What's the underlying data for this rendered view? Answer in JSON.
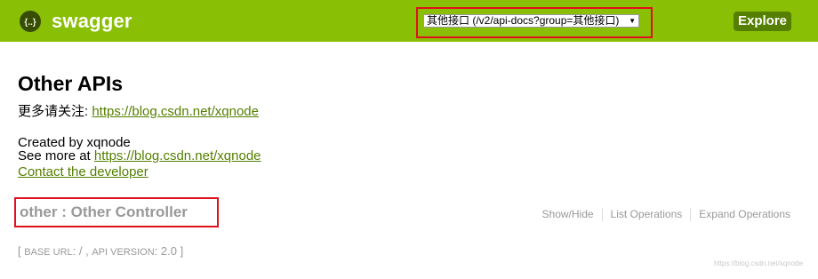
{
  "header": {
    "logo_text": "swagger",
    "api_select_value": "其他接口 (/v2/api-docs?group=其他接口)",
    "explore_label": "Explore",
    "colors": {
      "bar": "#89bf04",
      "button": "#547f00",
      "highlight": "#e0101c"
    }
  },
  "info": {
    "title": "Other APIs",
    "desc_prefix": "更多请关注: ",
    "desc_link": "https://blog.csdn.net/xqnode",
    "created_by": "Created by xqnode",
    "see_more_prefix": "See more at ",
    "see_more_link": "https://blog.csdn.net/xqnode",
    "contact": "Contact the developer"
  },
  "resource": {
    "title": "other : Other Controller",
    "ops": [
      "Show/Hide",
      "List Operations",
      "Expand Operations"
    ]
  },
  "footer": {
    "open_bracket": "[",
    "base_url_label": "BASE URL",
    "base_url_value": ": / , ",
    "api_version_label": "API VERSION",
    "api_version_value": ": 2.0 ",
    "close_bracket": "]"
  },
  "watermark": "https://blog.csdn.net/xqnode",
  "icons": {
    "logo": "swagger-logo-icon",
    "dropdown": "dropdown-arrow-icon"
  }
}
